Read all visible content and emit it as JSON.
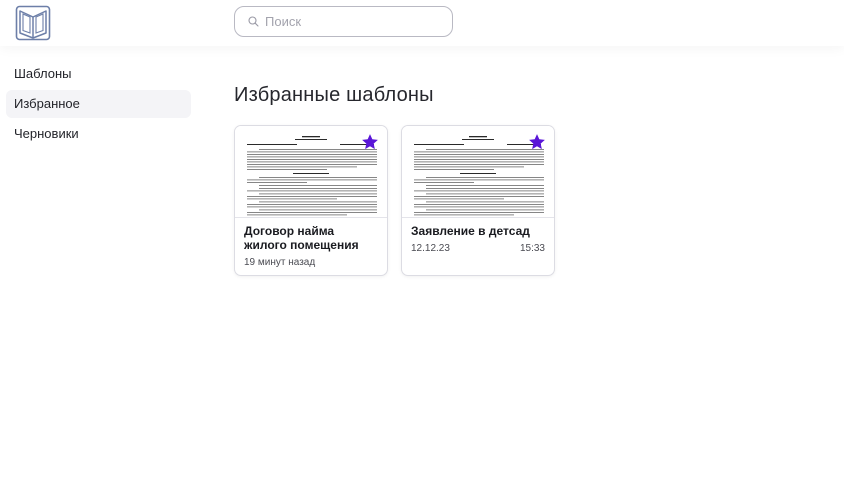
{
  "header": {
    "logo": "book-logo-icon",
    "search": {
      "placeholder": "Поиск",
      "value": "",
      "icon": "search-icon"
    }
  },
  "sidebar": {
    "items": [
      {
        "label": "Шаблоны",
        "active": false
      },
      {
        "label": "Избранное",
        "active": true
      },
      {
        "label": "Черновики",
        "active": false
      }
    ]
  },
  "main": {
    "title": "Избранные шаблоны",
    "cards": [
      {
        "title": "Договор найма жилого помещения",
        "date": "19 минут назад",
        "time": "",
        "favorite": true,
        "preview": "document-thumbnail"
      },
      {
        "title": "Заявление в детсад",
        "date": "12.12.23",
        "time": "15:33",
        "favorite": true,
        "preview": "document-thumbnail"
      }
    ]
  },
  "colors": {
    "accent_star": "#5a16d8",
    "logo_stroke": "#6d7fa8",
    "active_bg": "#f4f4f7",
    "border": "#dcdce3"
  }
}
